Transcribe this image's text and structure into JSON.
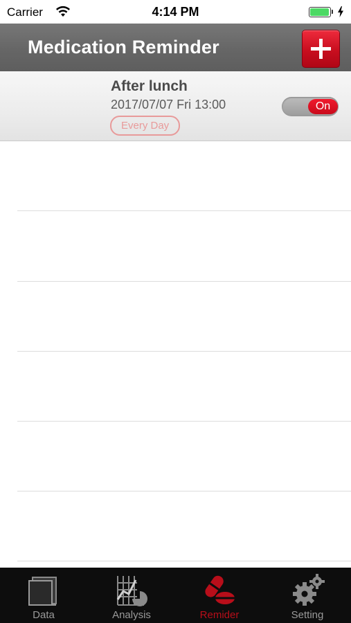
{
  "status_bar": {
    "carrier": "Carrier",
    "time": "4:14 PM",
    "battery_level": 1.0,
    "battery_color": "#4cd964",
    "icons": [
      "wifi-icon",
      "battery-icon",
      "charging-bolt-icon"
    ]
  },
  "header": {
    "title": "Medication Reminder",
    "add_icon": "plus-icon",
    "background": "#666666",
    "add_button_color": "#d8162a"
  },
  "reminders": [
    {
      "title": "After lunch",
      "datetime": "2017/07/07 Fri 13:00",
      "repeat": "Every Day",
      "toggle_label": "On",
      "enabled": true
    }
  ],
  "tabs": [
    {
      "label": "Data",
      "icon": "notebook-icon",
      "active": false
    },
    {
      "label": "Analysis",
      "icon": "chart-grid-icon",
      "active": false
    },
    {
      "label": "Remider",
      "icon": "pill-icon",
      "active": true
    },
    {
      "label": "Setting",
      "icon": "gears-icon",
      "active": false
    }
  ],
  "colors": {
    "accent": "#c90b1c",
    "tab_active": "#b80e1a",
    "tab_inactive": "#9a9a9a",
    "repeat_badge": "#e89a9a"
  }
}
